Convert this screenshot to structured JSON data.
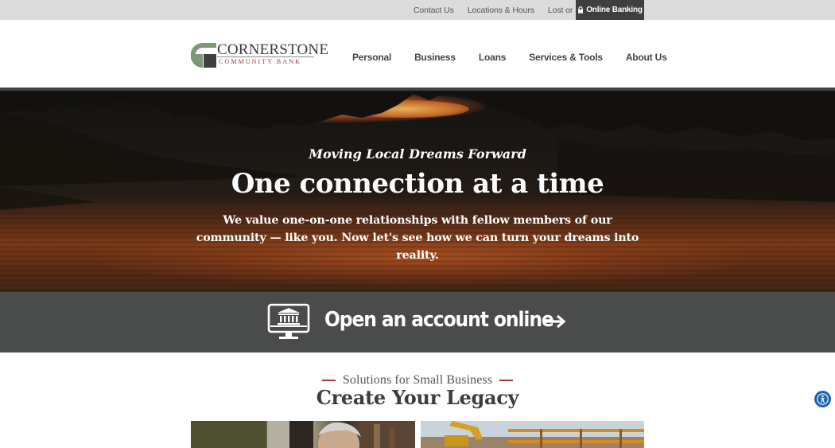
{
  "utility_bar": {
    "links": [
      "Contact Us",
      "Locations & Hours",
      "Lost or Stolen Card"
    ],
    "search_icon": "search-icon",
    "online_banking_label": "Online Banking",
    "lock_icon": "lock-icon"
  },
  "logo": {
    "name": "CORNERSTONE",
    "subtitle": "COMMUNITY BANK",
    "colors": {
      "green": "#7c9877",
      "dark": "#3f3f3f",
      "red": "#a23a3e"
    }
  },
  "nav": {
    "items": [
      "Personal",
      "Business",
      "Loans",
      "Services & Tools",
      "About Us"
    ]
  },
  "hero": {
    "kicker": "Moving Local Dreams Forward",
    "title": "One connection at a time",
    "body": "We value one-on-one relationships with fellow members of our community — like you. Now let's see how we can turn your dreams into reality."
  },
  "cta": {
    "label": "Open an account online",
    "icon": "bank-computer-icon",
    "arrow_icon": "arrow-right-icon"
  },
  "solutions": {
    "kicker": "Solutions for Small Business",
    "title": "Create Your Legacy"
  },
  "accessibility": {
    "icon": "accessibility-icon",
    "color": "#1a64b5"
  },
  "colors": {
    "utility_bg": "#dcdcdc",
    "dark_band": "#4a4b4b",
    "accent_red": "#a23a3e"
  }
}
